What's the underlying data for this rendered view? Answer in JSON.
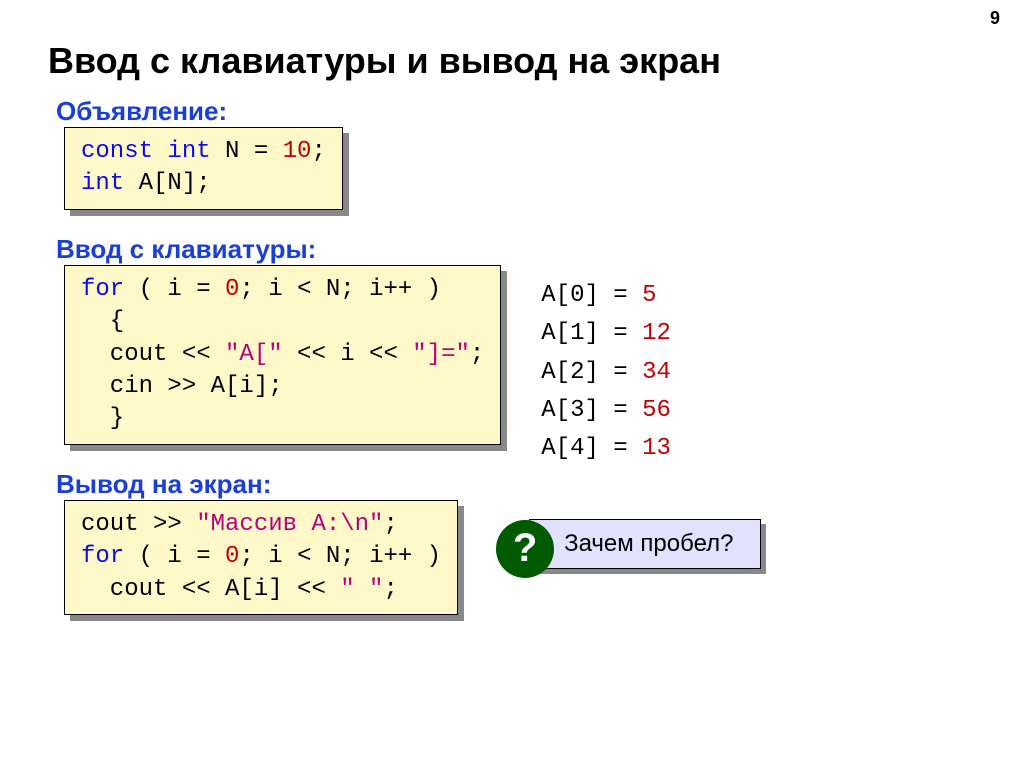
{
  "page_number": "9",
  "title": "Ввод с клавиатуры и вывод на экран",
  "section1": {
    "heading": "Объявление:",
    "code": {
      "l1_const": "const",
      "l1_int": " int",
      "l1_rest": " N = ",
      "l1_num": "10",
      "l1_semi": ";",
      "l2_int": "int",
      "l2_rest": " A[N];"
    }
  },
  "section2": {
    "heading": "Ввод с клавиатуры:",
    "code": {
      "l1_for": "for",
      "l1_a": " ( i = ",
      "l1_zero": "0",
      "l1_b": "; i < N; i++ )",
      "l2": "  {",
      "l3_a": "  cout << ",
      "l3_s1": "\"A[\"",
      "l3_b": " << i << ",
      "l3_s2": "\"]=\"",
      "l3_c": ";",
      "l4": "  cin >> A[i];",
      "l5": "  }"
    },
    "sample": [
      {
        "label": "A[0] = ",
        "value": "5"
      },
      {
        "label": "A[1] = ",
        "value": "12"
      },
      {
        "label": "A[2] = ",
        "value": "34"
      },
      {
        "label": "A[3] = ",
        "value": "56"
      },
      {
        "label": "A[4] = ",
        "value": "13"
      }
    ]
  },
  "section3": {
    "heading": "Вывод на экран:",
    "code": {
      "l1_a": "cout >> ",
      "l1_s": "\"Массив A:\\n\"",
      "l1_b": ";",
      "l2_for": "for",
      "l2_a": " ( i = ",
      "l2_zero": "0",
      "l2_b": "; i < N; i++ )",
      "l3_a": "  cout << A[i] << ",
      "l3_s": "\" \"",
      "l3_b": ";"
    }
  },
  "question": {
    "mark": "?",
    "text": "Зачем пробел?"
  }
}
